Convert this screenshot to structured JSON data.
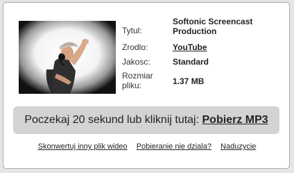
{
  "info": {
    "title_label": "Tytul:",
    "title_value": "Softonic Screencast Production",
    "source_label": "Zrodlo:",
    "source_value": "YouTube",
    "quality_label": "Jakosc:",
    "quality_value": "Standard",
    "size_label": "Rozmiar pliku:",
    "size_value": "1.37 MB"
  },
  "download_bar": {
    "prompt": "Poczekaj 20 sekund lub kliknij tutaj:",
    "link_label": "Pobierz MP3"
  },
  "footer_links": [
    {
      "label": "Skonwertuj inny plik wideo"
    },
    {
      "label": "Pobieranie nie dziala?"
    },
    {
      "label": "Naduzycie"
    }
  ],
  "colors": {
    "panel_bg": "#ffffff",
    "page_bg": "#e6e6e6",
    "bar_bg": "#d3d3d3",
    "text": "#222222"
  }
}
